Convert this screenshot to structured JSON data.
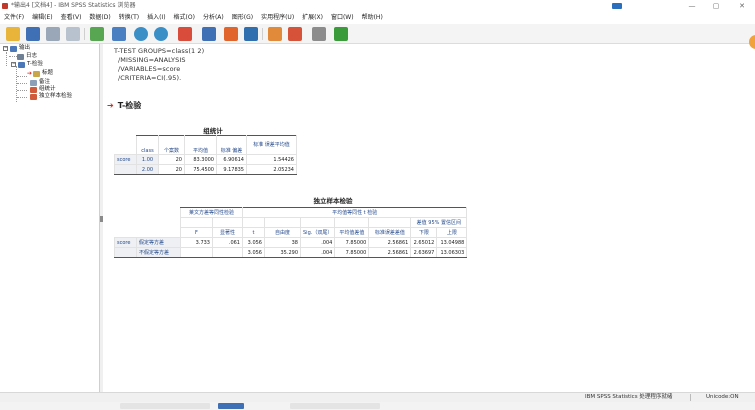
{
  "window": {
    "title": "*输出4 [文档4] - IBM SPSS Statistics 浏览器",
    "minimize_glyph": "—",
    "maximize_glyph": "▢",
    "close_glyph": "✕"
  },
  "menu": [
    "文件(F)",
    "编辑(E)",
    "查看(V)",
    "数据(D)",
    "转换(T)",
    "插入(I)",
    "格式(O)",
    "分析(A)",
    "图形(G)",
    "实用程序(U)",
    "扩展(X)",
    "窗口(W)",
    "帮助(H)"
  ],
  "toolbar": {
    "icons": [
      "open-icon",
      "save-icon",
      "print-icon",
      "print-preview-icon",
      "export-icon",
      "dialog-recall-icon",
      "undo-icon",
      "redo-icon",
      "goto-data-icon",
      "goto-case-icon",
      "goto-variable-icon",
      "variables-icon",
      "insert-output-icon",
      "designate-window-icon",
      "stop-icon",
      "run-icon"
    ]
  },
  "outline": {
    "root": "输出",
    "log": "日志",
    "ttest": "T-检验",
    "children": [
      "标题",
      "备注",
      "组统计",
      "独立样本检验"
    ]
  },
  "syntax": [
    "T-TEST GROUPS=class(1 2)",
    "/MISSING=ANALYSIS",
    "/VARIABLES=score",
    "/CRITERIA=CI(.95)."
  ],
  "section_heading": "T-检验",
  "group_stats": {
    "title": "组统计",
    "headers": [
      "class",
      "个案数",
      "平均值",
      "标准 偏差",
      "标准 误差平均值"
    ],
    "variable": "score",
    "rows": [
      [
        "1.00",
        "20",
        "83.3000",
        "6.90614",
        "1.54426"
      ],
      [
        "2.00",
        "20",
        "75.4500",
        "9.17835",
        "2.05234"
      ]
    ]
  },
  "independent_test": {
    "title": "独立样本检验",
    "levene_header": "莱文方差等同性检验",
    "ttest_header": "平均值等同性 t 检验",
    "ci_header": "差值 95% 置信区间",
    "headers": [
      "F",
      "显著性",
      "t",
      "自由度",
      "Sig.（双尾）",
      "平均值差值",
      "标准误差差值",
      "下限",
      "上限"
    ],
    "variable": "score",
    "rows": [
      {
        "label": "假定等方差",
        "values": [
          "3.733",
          ".061",
          "3.056",
          "38",
          ".004",
          "7.85000",
          "2.56861",
          "2.65012",
          "13.04988"
        ]
      },
      {
        "label": "不假定等方差",
        "values": [
          "",
          "",
          "3.056",
          "35.290",
          ".004",
          "7.85000",
          "2.56861",
          "2.63697",
          "13.06303"
        ]
      }
    ]
  },
  "status": {
    "main": "IBM SPSS Statistics 处理程序就绪",
    "unicode": "Unicode:ON"
  },
  "colors": {
    "accent_red": "#d62a1e",
    "header_blue": "#254a8c",
    "row_shade": "#eef0f4"
  }
}
